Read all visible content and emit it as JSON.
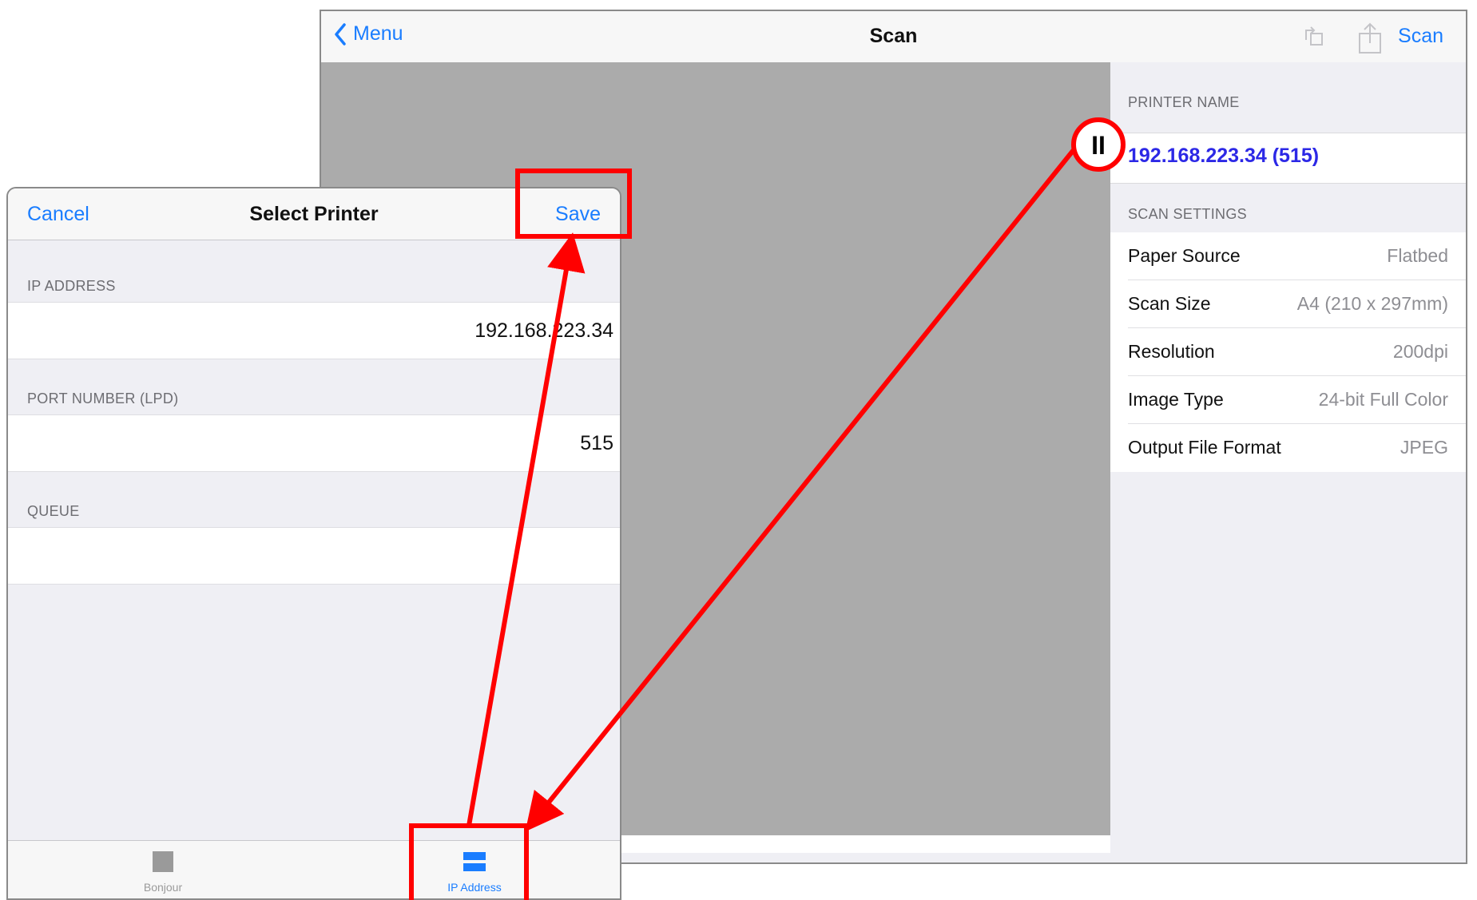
{
  "scan_window": {
    "back_label": "Menu",
    "title": "Scan",
    "action_label": "Scan",
    "printer_section_header": "PRINTER NAME",
    "printer_name": "192.168.223.34  (515)",
    "settings_header": "SCAN SETTINGS",
    "settings": [
      {
        "label": "Paper Source",
        "value": "Flatbed"
      },
      {
        "label": "Scan Size",
        "value": "A4 (210 x 297mm)"
      },
      {
        "label": "Resolution",
        "value": "200dpi"
      },
      {
        "label": "Image Type",
        "value": "24-bit Full Color"
      },
      {
        "label": "Output File Format",
        "value": "JPEG"
      }
    ],
    "icons": [
      "back-chevron-icon",
      "rotate-icon",
      "share-icon"
    ]
  },
  "select_printer": {
    "cancel_label": "Cancel",
    "title": "Select Printer",
    "save_label": "Save",
    "ip_header": "IP ADDRESS",
    "ip_value": "192.168.223.34",
    "port_header": "PORT NUMBER (LPD)",
    "port_value": "515",
    "queue_header": "QUEUE",
    "queue_value": "",
    "tabs": [
      {
        "label": "Bonjour",
        "icon": "bonjour-square-icon",
        "selected": false
      },
      {
        "label": "IP Address",
        "icon": "ip-address-bars-icon",
        "selected": true
      }
    ]
  },
  "callout": {
    "label": "II"
  },
  "colors": {
    "accent": "#1a7dff",
    "annotation": "#ff0000",
    "printer_name": "#2c28e6"
  }
}
